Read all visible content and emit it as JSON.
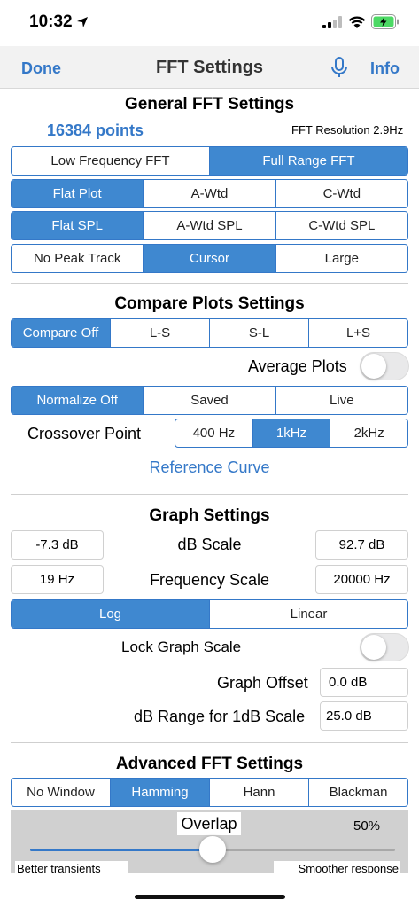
{
  "status": {
    "time": "10:32"
  },
  "nav": {
    "done": "Done",
    "title": "FFT Settings",
    "info": "Info"
  },
  "general": {
    "title": "General FFT Settings",
    "points": "16384 points",
    "resolution": "FFT Resolution 2.9Hz",
    "range_seg": [
      "Low Frequency FFT",
      "Full Range FFT"
    ],
    "weight_seg": [
      "Flat Plot",
      "A-Wtd",
      "C-Wtd"
    ],
    "spl_seg": [
      "Flat SPL",
      "A-Wtd SPL",
      "C-Wtd SPL"
    ],
    "peak_seg": [
      "No Peak Track",
      "Cursor",
      "Large"
    ]
  },
  "compare": {
    "title": "Compare Plots Settings",
    "compare_seg": [
      "Compare Off",
      "L-S",
      "S-L",
      "L+S"
    ],
    "average_label": "Average Plots",
    "normalize_seg": [
      "Normalize Off",
      "Saved",
      "Live"
    ],
    "crossover_label": "Crossover Point",
    "crossover_seg": [
      "400 Hz",
      "1kHz",
      "2kHz"
    ],
    "reference_curve": "Reference Curve"
  },
  "graph": {
    "title": "Graph Settings",
    "db_min": "-7.3 dB",
    "db_scale_label": "dB Scale",
    "db_max": "92.7 dB",
    "freq_min": "19 Hz",
    "freq_scale_label": "Frequency Scale",
    "freq_max": "20000 Hz",
    "scale_seg": [
      "Log",
      "Linear"
    ],
    "lock_label": "Lock Graph Scale",
    "offset_label": "Graph Offset",
    "offset_value": "0.0 dB",
    "range_label": "dB Range for 1dB Scale",
    "range_value": "25.0 dB"
  },
  "advanced": {
    "title": "Advanced FFT Settings",
    "window_seg": [
      "No Window",
      "Hamming",
      "Hann",
      "Blackman"
    ],
    "overlap_label": "Overlap",
    "overlap_value": "50%",
    "overlap_fraction": 0.5,
    "hint_left": "Better transients",
    "hint_right": "Smoother response"
  },
  "colors": {
    "accent": "#3f88d0",
    "link": "#3478c8",
    "battery": "#4cd964"
  }
}
